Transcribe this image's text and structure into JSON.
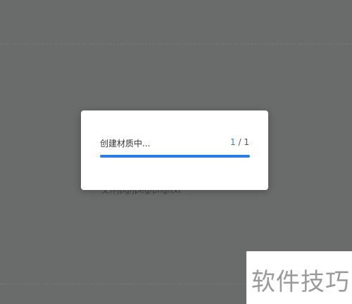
{
  "background": {
    "overlay_color": "#6a6b6b",
    "behind_text": "文件jpg/jpeg/png/txt"
  },
  "dialog": {
    "title": "创建材质中...",
    "count": {
      "current": "1",
      "separator": " / ",
      "total": "1"
    },
    "progress": 1.0,
    "accent_color": "#2b7de1"
  },
  "watermark": {
    "text": "软件技巧"
  }
}
